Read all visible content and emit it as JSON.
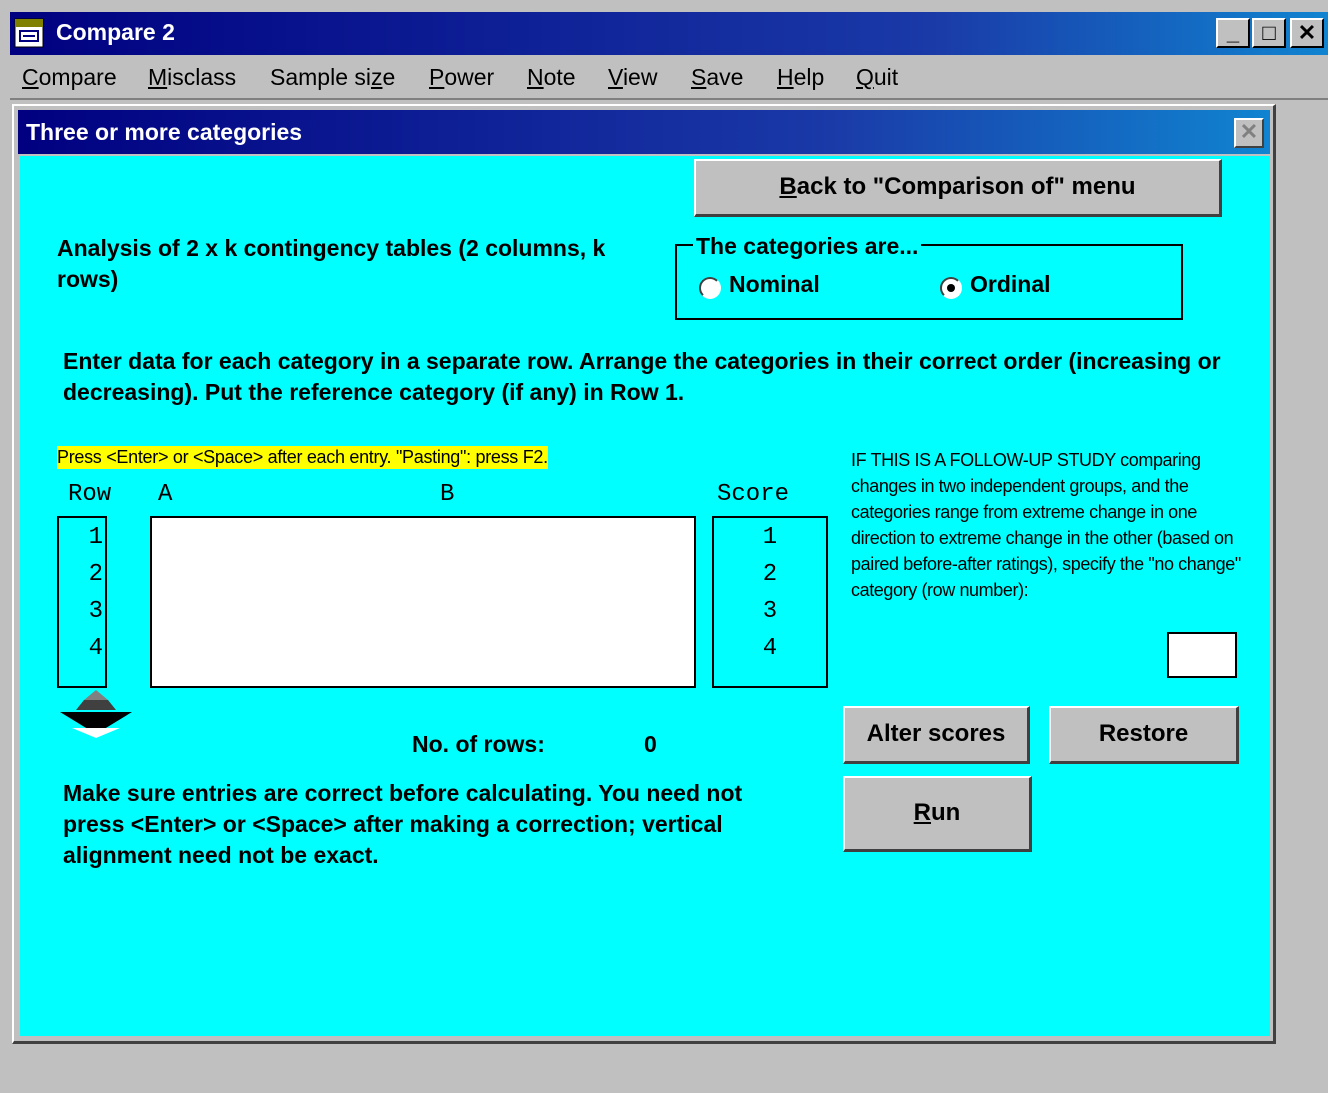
{
  "app": {
    "title": "Compare 2",
    "controls": {
      "minimize": "_",
      "maximize": "□",
      "close": "✕"
    }
  },
  "menu": [
    {
      "pre": "",
      "key": "C",
      "post": "ompare"
    },
    {
      "pre": "",
      "key": "M",
      "post": "isclass"
    },
    {
      "pre": "Sample si",
      "key": "z",
      "post": "e"
    },
    {
      "pre": "",
      "key": "P",
      "post": "ower"
    },
    {
      "pre": "",
      "key": "N",
      "post": "ote"
    },
    {
      "pre": "",
      "key": "V",
      "post": "iew"
    },
    {
      "pre": "",
      "key": "S",
      "post": "ave"
    },
    {
      "pre": "",
      "key": "H",
      "post": "elp"
    },
    {
      "pre": "",
      "key": "Q",
      "post": "uit"
    }
  ],
  "dialog": {
    "title": "Three or more categories",
    "close": "✕",
    "back_button": {
      "key": "B",
      "rest": "ack to \"Comparison of\" menu"
    },
    "analysis_text": "Analysis of 2 x k contingency tables  (2 columns, k rows)",
    "categories": {
      "legend": "The categories are...",
      "nominal": "Nominal",
      "ordinal": "Ordinal",
      "selected": "Ordinal"
    },
    "instructions": "Enter data for each category in a separate row.  Arrange the categories in their correct order  (increasing or decreasing).  Put the reference category (if any) in Row 1.",
    "hint": "Press <Enter> or <Space> after each entry.  \"Pasting\": press F2.",
    "table": {
      "header_row": "Row",
      "header_a": "A",
      "header_b": "B",
      "header_score": "Score",
      "rows": [
        "1",
        "2",
        "3",
        "4"
      ],
      "scores": [
        "1",
        "2",
        "3",
        "4"
      ]
    },
    "rows_label": "No. of rows:",
    "rows_value": "0",
    "correction_note": "Make sure entries are correct before calculating. You need not press <Enter> or <Space> after making a correction; vertical alignment need not be exact.",
    "followup_note": "IF THIS IS A FOLLOW-UP STUDY comparing changes in two independent groups, and the categories range from extreme change in one direction to extreme change in the other (based on paired before-after ratings), specify the \"no change\" category (row number):",
    "no_change_value": "",
    "alter_scores": "Alter scores",
    "restore": "Restore",
    "run": {
      "key": "R",
      "rest": "un"
    }
  },
  "colors": {
    "content_bg": "#00ffff",
    "hint_bg": "#ffff00",
    "title_bg": "#000080"
  }
}
